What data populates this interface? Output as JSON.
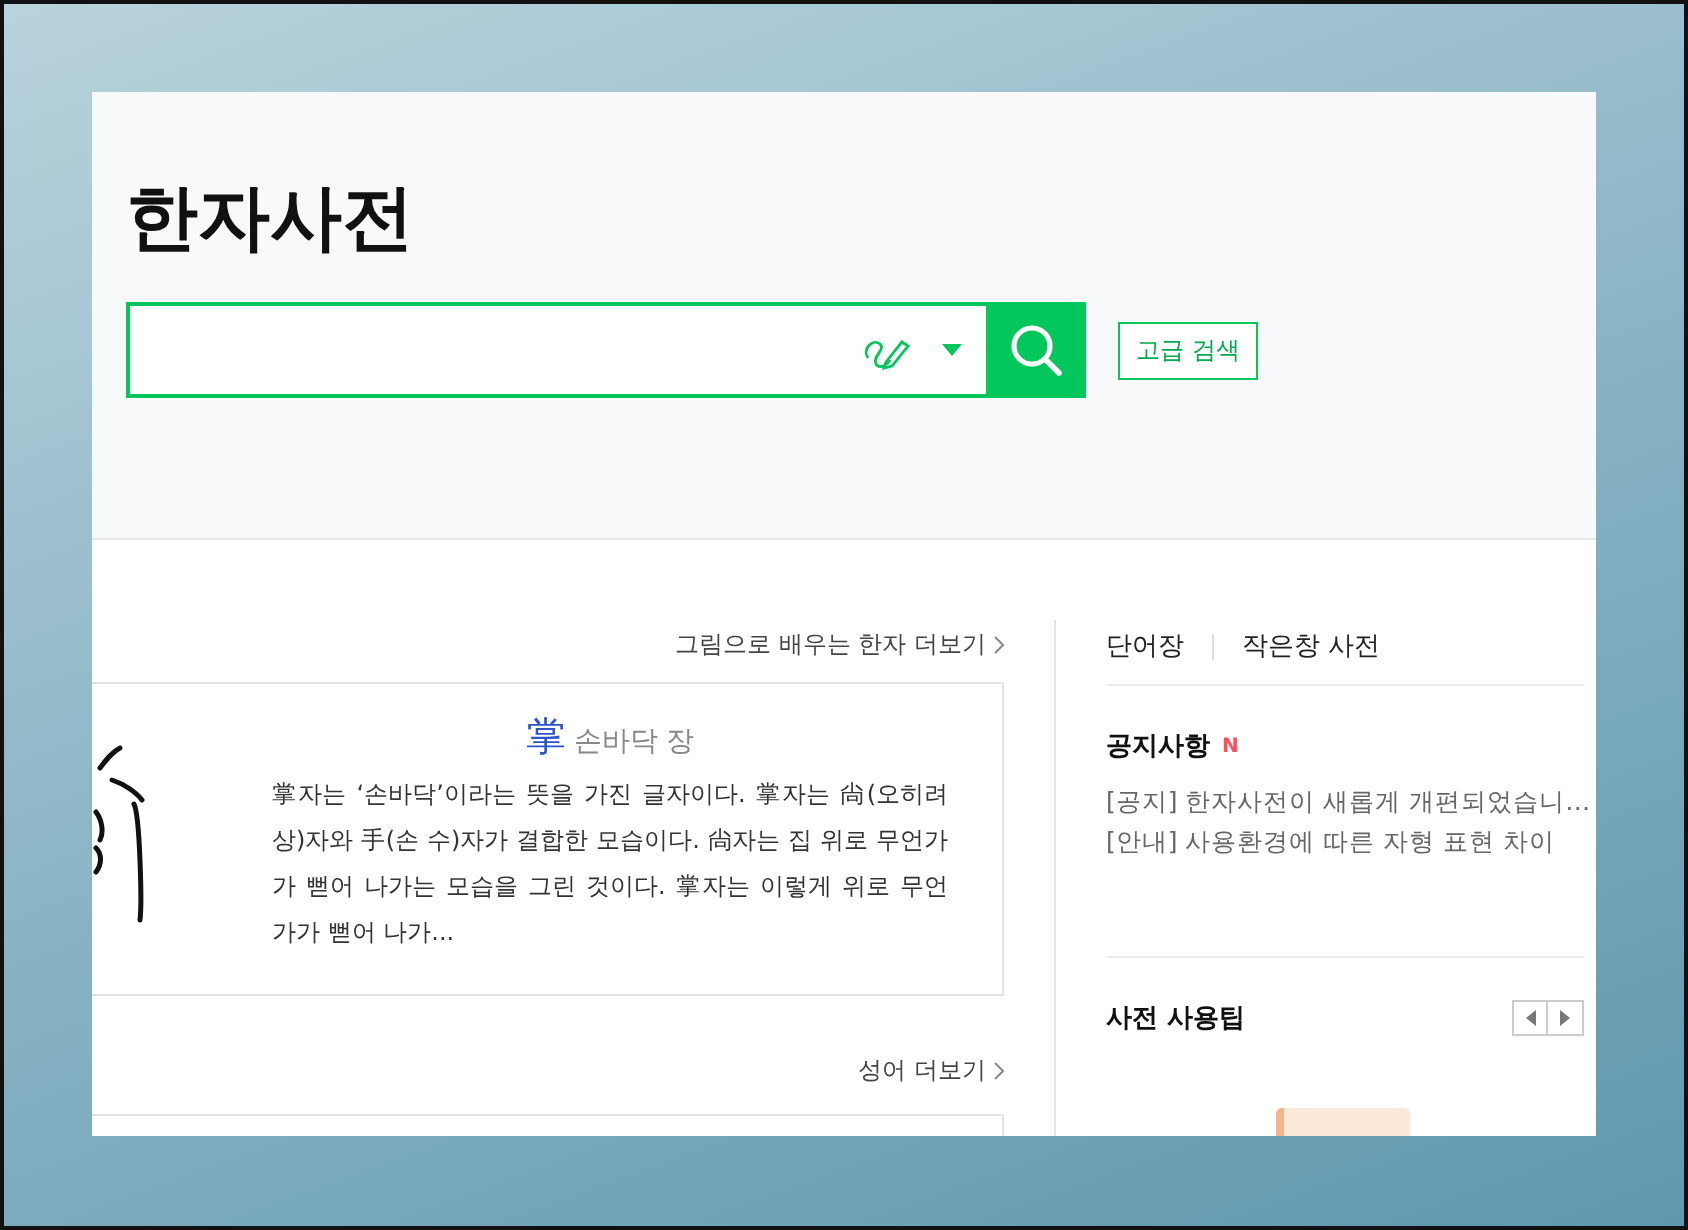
{
  "header": {
    "title": "한자사전",
    "advanced_search": "고급 검색"
  },
  "sections": [
    {
      "more_link": "그림으로 배우는 한자 더보기",
      "card": {
        "character": "掌",
        "reading": "손바닥 장",
        "description": "掌자는 ‘손바닥’이라는 뜻을 가진 글자이다. 掌자는 尙(오히려 상)자와 手(손 수)자가 결합한 모습이다. 尙자는 집 위로 무언가가 뻗어 나가는 모습을 그린 것이다. 掌자는 이렇게 위로 무언가가 뻗어 나가..."
      }
    },
    {
      "more_link": "성어 더보기"
    }
  ],
  "side": {
    "links": [
      "단어장",
      "작은창 사전"
    ],
    "notices": {
      "title": "공지사항",
      "badge": "N",
      "items": [
        {
          "tag": "[공지]",
          "text": "한자사전이 새롭게 개편되었습니…"
        },
        {
          "tag": "[안내]",
          "text": "사용환경에 따른 자형 표현 차이"
        }
      ]
    },
    "tips": {
      "title": "사전 사용팁"
    }
  }
}
